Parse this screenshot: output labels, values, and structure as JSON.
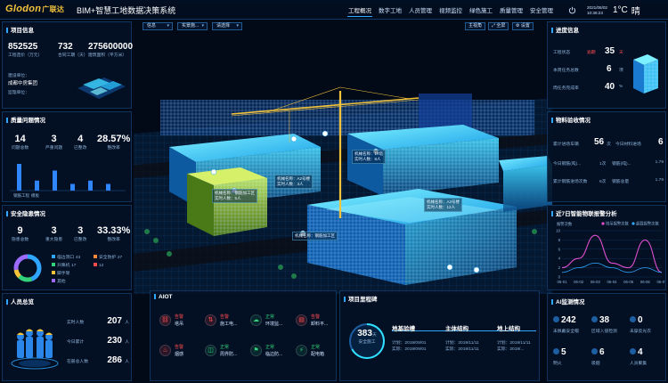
{
  "header": {
    "logo": "Glodon",
    "logo_cn": "广联达",
    "title": "BIM+智慧工地数据决策系统",
    "nav": [
      "工程概况",
      "数字工地",
      "人员管理",
      "视频监控",
      "绿色施工",
      "质量管理",
      "安全管理"
    ],
    "active_nav": 0,
    "date": "2021/06/02",
    "time": "10:36:23",
    "temperature": "1°C",
    "weather": "晴"
  },
  "toolbar": {
    "dropdowns": [
      "信息",
      "实景施...",
      "请选择"
    ],
    "buttons": [
      "主视角",
      "全屏",
      "设置"
    ]
  },
  "project_info": {
    "title": "项目信息",
    "kpis": [
      {
        "value": "852525",
        "label": "工程造价（万元）"
      },
      {
        "value": "732",
        "label": "合同工期（天）"
      },
      {
        "value": "275600000",
        "label": "建筑面积（平方米）"
      }
    ],
    "builder_label": "建设单位：",
    "builder_value": "成都中房集团",
    "supervisor_label": "监理单位："
  },
  "quality": {
    "title": "质量问题情况",
    "kpis": [
      {
        "value": "14",
        "label": "问题总数"
      },
      {
        "value": "3",
        "label": "严重问题"
      },
      {
        "value": "4",
        "label": "已整改"
      },
      {
        "value": "28.57%",
        "label": "整改率"
      }
    ],
    "bar_values": [
      8,
      3,
      6,
      2,
      3,
      2
    ],
    "bar_labels": [
      "钢筋工程",
      "模板",
      "",
      "",
      "",
      ""
    ]
  },
  "safety": {
    "title": "安全隐患情况",
    "kpis": [
      {
        "value": "9",
        "label": "隐患总数"
      },
      {
        "value": "3",
        "label": "重大隐患"
      },
      {
        "value": "3",
        "label": "已整改"
      },
      {
        "value": "33.33%",
        "label": "整改率"
      }
    ],
    "legend": [
      {
        "name": "临边洞口",
        "count": "43",
        "color": "#2fa6ff"
      },
      {
        "name": "升降机",
        "count": "17",
        "color": "#32d17a"
      },
      {
        "name": "脚手架",
        "count": "",
        "color": "#f4c33a"
      },
      {
        "name": "其他",
        "count": "",
        "color": "#9b6bff"
      }
    ],
    "legend_right": [
      {
        "name": "安全防护",
        "count": "27"
      },
      {
        "name": "",
        "count": "12"
      },
      {
        "name": "",
        "count": ""
      }
    ],
    "donut": [
      43,
      17,
      10,
      27
    ]
  },
  "personnel": {
    "title": "人员总览",
    "rows": [
      {
        "label": "实时人数",
        "value": "207",
        "unit": "人"
      },
      {
        "label": "今日累计",
        "value": "230",
        "unit": "人"
      },
      {
        "label": "在册总人数",
        "value": "286",
        "unit": "人"
      }
    ]
  },
  "aiot": {
    "title": "AIOT",
    "items": [
      {
        "status": "告警",
        "name": "塔吊",
        "type": "alarm",
        "icon": "tower-crane-icon"
      },
      {
        "status": "告警",
        "name": "施工电...",
        "type": "alarm",
        "icon": "elevator-icon"
      },
      {
        "status": "正常",
        "name": "环境监...",
        "type": "ok",
        "icon": "environment-icon"
      },
      {
        "status": "告警",
        "name": "卸料平...",
        "type": "alarm",
        "icon": "platform-icon"
      },
      {
        "status": "告警",
        "name": "烟感",
        "type": "alarm",
        "icon": "smoke-icon"
      },
      {
        "status": "正常",
        "name": "周界防...",
        "type": "ok",
        "icon": "perimeter-icon"
      },
      {
        "status": "正常",
        "name": "临边防...",
        "type": "ok",
        "icon": "edge-guard-icon"
      },
      {
        "status": "正常",
        "name": "配电箱",
        "type": "ok",
        "icon": "power-box-icon"
      }
    ]
  },
  "milestones": {
    "title": "项目里程碑",
    "safe_days": "383",
    "safe_days_unit": "天",
    "safe_days_label": "安全施工",
    "items": [
      {
        "name": "地基验槽",
        "plan": "计划：2019/09/01",
        "actual": "实际：2019/09/01"
      },
      {
        "name": "主体结构",
        "plan": "计划：2019/11/11",
        "actual": "实际：2019/11/11"
      },
      {
        "name": "地上结构",
        "plan": "计划：2019/11/11",
        "actual": "实际：2019/..."
      }
    ]
  },
  "schedule": {
    "title": "进度信息",
    "rows": [
      {
        "label": "工程状态",
        "tag": "逾期",
        "value": "35",
        "unit": "天"
      },
      {
        "label": "本周任务总数",
        "tag": "",
        "value": "6",
        "unit": "项"
      },
      {
        "label": "周任务完成率",
        "tag": "",
        "value": "40",
        "unit": "%"
      }
    ]
  },
  "materials": {
    "title": "物料验收情况",
    "left_label": "累计进场车辆",
    "left_value": "56",
    "left_unit": "次",
    "right_label": "今日材料进场",
    "right_value": "6",
    "rows": [
      {
        "label": "今日钢筋(吨)...",
        "v1": "1次",
        "label2": "钢筋(吨)...",
        "v2": "1.79"
      },
      {
        "label": "累计钢筋进场次数",
        "v1": "6次",
        "label2": "钢筋总量",
        "v2": "1.79"
      }
    ]
  },
  "trend": {
    "title": "近7日智能物联报警分析",
    "ylabel": "报警次数",
    "legend": [
      "塔吊报警次数",
      "超载报警次数"
    ],
    "yticks": [
      "10",
      "8",
      "6",
      "4",
      "2",
      "0"
    ],
    "xticks": [
      "06-01",
      "06-02",
      "06-03",
      "06-04",
      "06-05",
      "06-06",
      "06-07"
    ]
  },
  "chart_data": {
    "type": "line",
    "title": "近7日智能物联报警分析",
    "xlabel": "",
    "ylabel": "报警次数",
    "x": [
      "06-01",
      "06-02",
      "06-03",
      "06-04",
      "06-05",
      "06-06",
      "06-07"
    ],
    "ylim": [
      0,
      10
    ],
    "series": [
      {
        "name": "塔吊报警次数",
        "values": [
          2,
          4,
          9,
          3,
          2,
          8,
          1
        ]
      },
      {
        "name": "超载报警次数",
        "values": [
          1,
          2,
          3,
          2,
          1,
          2,
          1
        ]
      }
    ]
  },
  "ai_monitor": {
    "title": "AI监测情况",
    "cells": [
      {
        "value": "242",
        "label": "未佩戴安全帽"
      },
      {
        "value": "38",
        "label": "区域入侵检测"
      },
      {
        "value": "0",
        "label": "未穿反光衣"
      },
      {
        "value": "5",
        "label": "明火"
      },
      {
        "value": "6",
        "label": "吸烟"
      },
      {
        "value": "4",
        "label": "人员聚集"
      }
    ]
  },
  "scene_labels": [
    {
      "t1": "机械名称：1#塔",
      "t2": "实时人数：8人"
    },
    {
      "t1": "机械名称：钢筋加工区",
      "t2": "实时人数：5人"
    },
    {
      "t1": "机械名称：钢筋加工区",
      "t2": "实时人数：3人"
    },
    {
      "t1": "机械名称：A2号楼",
      "t2": "实时人数：3人"
    },
    {
      "t1": "机械名称：A3号楼",
      "t2": "实时人数：12人"
    },
    {
      "t1": "机械名称：41号楼",
      "t2": "实时人数：2人"
    }
  ]
}
